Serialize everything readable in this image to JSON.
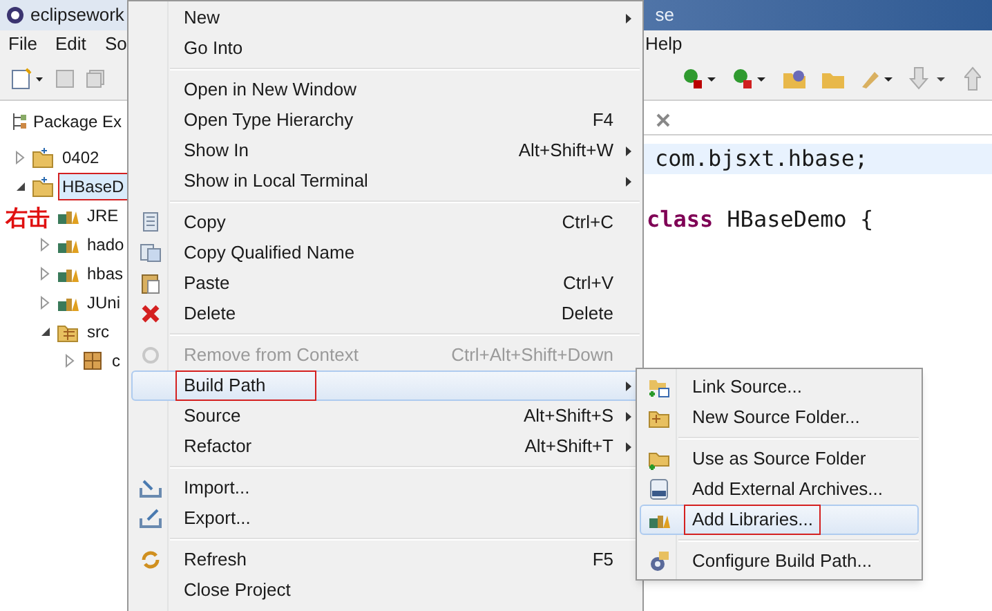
{
  "window": {
    "title": "eclipsework",
    "title_tail": "se"
  },
  "menu_bar": [
    "File",
    "Edit",
    "So",
    "Help"
  ],
  "package_explorer": {
    "title": "Package Ex",
    "tree": [
      {
        "label": "0402",
        "expanded": false,
        "selected": false,
        "annotated": false
      },
      {
        "label": "HBaseD",
        "expanded": true,
        "selected": true,
        "annotated": true,
        "children": [
          {
            "label": "JRE"
          },
          {
            "label": "hado",
            "expanded": false
          },
          {
            "label": "hbas",
            "expanded": false
          },
          {
            "label": "JUni",
            "expanded": false
          },
          {
            "label": "src",
            "expanded": true,
            "children": [
              {
                "label": "c",
                "expanded": false
              }
            ]
          }
        ]
      }
    ]
  },
  "annotation": "右击",
  "editor": {
    "lines": [
      {
        "text": "com.bjsxt.hbase;",
        "current": true
      },
      {
        "keyword": "class",
        "text": "HBaseDemo {",
        "current": false
      }
    ]
  },
  "context_menu": [
    {
      "kind": "item",
      "label": "New",
      "submenu": true,
      "disabled": false,
      "selected": false,
      "annotated": false
    },
    {
      "kind": "item",
      "label": "Go Into",
      "submenu": false,
      "disabled": false,
      "selected": false,
      "annotated": false
    },
    {
      "kind": "separator"
    },
    {
      "kind": "item",
      "label": "Open in New Window",
      "submenu": false,
      "disabled": false,
      "selected": false,
      "annotated": false
    },
    {
      "kind": "item",
      "label": "Open Type Hierarchy",
      "shortcut": "F4",
      "submenu": false,
      "disabled": false,
      "selected": false,
      "annotated": false
    },
    {
      "kind": "item",
      "label": "Show In",
      "shortcut": "Alt+Shift+W",
      "submenu": true,
      "disabled": false,
      "selected": false,
      "annotated": false
    },
    {
      "kind": "item",
      "label": "Show in Local Terminal",
      "submenu": true,
      "disabled": false,
      "selected": false,
      "annotated": false
    },
    {
      "kind": "separator"
    },
    {
      "kind": "item",
      "label": "Copy",
      "shortcut": "Ctrl+C",
      "submenu": false,
      "disabled": false,
      "selected": false,
      "annotated": false
    },
    {
      "kind": "item",
      "label": "Copy Qualified Name",
      "submenu": false,
      "disabled": false,
      "selected": false,
      "annotated": false
    },
    {
      "kind": "item",
      "label": "Paste",
      "shortcut": "Ctrl+V",
      "submenu": false,
      "disabled": false,
      "selected": false,
      "annotated": false
    },
    {
      "kind": "item",
      "label": "Delete",
      "shortcut": "Delete",
      "submenu": false,
      "disabled": false,
      "selected": false,
      "annotated": false
    },
    {
      "kind": "separator"
    },
    {
      "kind": "item",
      "label": "Remove from Context",
      "shortcut": "Ctrl+Alt+Shift+Down",
      "submenu": false,
      "disabled": true,
      "selected": false,
      "annotated": false
    },
    {
      "kind": "item",
      "label": "Build Path",
      "submenu": true,
      "disabled": false,
      "selected": true,
      "annotated": true
    },
    {
      "kind": "item",
      "label": "Source",
      "shortcut": "Alt+Shift+S",
      "submenu": true,
      "disabled": false,
      "selected": false,
      "annotated": false
    },
    {
      "kind": "item",
      "label": "Refactor",
      "shortcut": "Alt+Shift+T",
      "submenu": true,
      "disabled": false,
      "selected": false,
      "annotated": false
    },
    {
      "kind": "separator"
    },
    {
      "kind": "item",
      "label": "Import...",
      "submenu": false,
      "disabled": false,
      "selected": false,
      "annotated": false
    },
    {
      "kind": "item",
      "label": "Export...",
      "submenu": false,
      "disabled": false,
      "selected": false,
      "annotated": false
    },
    {
      "kind": "separator"
    },
    {
      "kind": "item",
      "label": "Refresh",
      "shortcut": "F5",
      "submenu": false,
      "disabled": false,
      "selected": false,
      "annotated": false
    },
    {
      "kind": "item",
      "label": "Close Project",
      "submenu": false,
      "disabled": false,
      "selected": false,
      "annotated": false
    }
  ],
  "build_path_submenu": [
    {
      "kind": "item",
      "label": "Link Source...",
      "selected": false,
      "annotated": false
    },
    {
      "kind": "item",
      "label": "New Source Folder...",
      "selected": false,
      "annotated": false
    },
    {
      "kind": "separator"
    },
    {
      "kind": "item",
      "label": "Use as Source Folder",
      "selected": false,
      "annotated": false
    },
    {
      "kind": "item",
      "label": "Add External Archives...",
      "selected": false,
      "annotated": false
    },
    {
      "kind": "item",
      "label": "Add Libraries...",
      "selected": true,
      "annotated": true
    },
    {
      "kind": "separator"
    },
    {
      "kind": "item",
      "label": "Configure Build Path...",
      "selected": false,
      "annotated": false
    }
  ]
}
